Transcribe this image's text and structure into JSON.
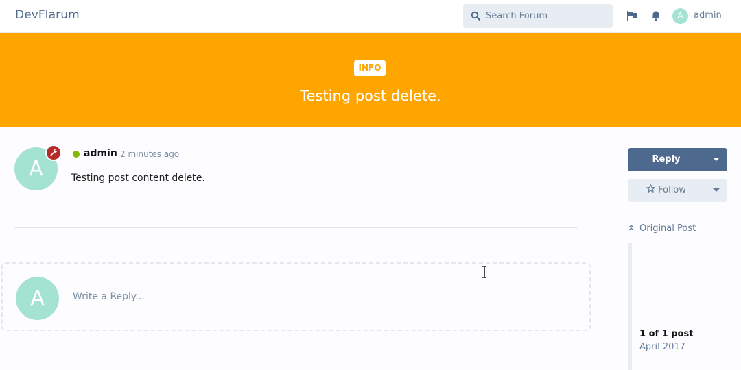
{
  "header": {
    "brand": "DevFlarum",
    "search_placeholder": "Search Forum",
    "user_initial": "A",
    "username": "admin"
  },
  "hero": {
    "tag": "INFO",
    "title": "Testing post delete."
  },
  "post": {
    "avatar_initial": "A",
    "author": "admin",
    "time": "2 minutes ago",
    "body": "Testing post content delete."
  },
  "composer": {
    "avatar_initial": "A",
    "placeholder": "Write a Reply..."
  },
  "sidebar": {
    "reply_label": "Reply",
    "follow_label": "Follow",
    "original_post_label": "Original Post",
    "post_count": "1 of 1 post",
    "date": "April 2017"
  },
  "colors": {
    "primary": "#4d698e",
    "hero": "#ffa500",
    "avatar": "#a4e3d1",
    "badge": "#b72a2a",
    "online": "#7fba00"
  }
}
